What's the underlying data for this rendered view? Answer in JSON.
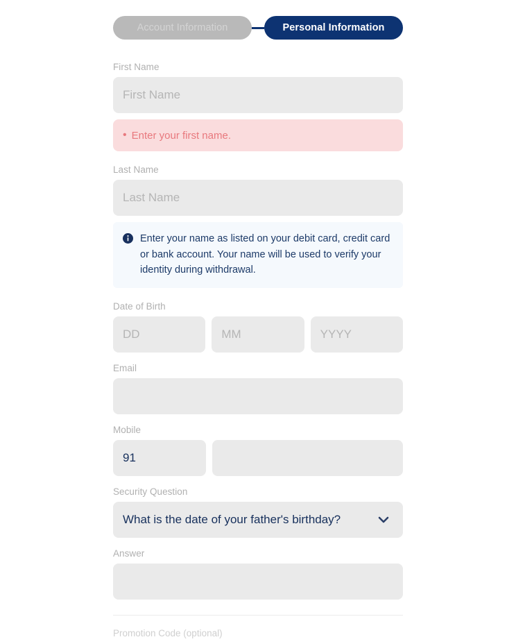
{
  "stepper": {
    "steps": [
      {
        "label": "Account Information",
        "state": "done"
      },
      {
        "label": "Personal Information",
        "state": "active"
      }
    ],
    "active_color": "#0d3372",
    "done_color": "#b9b9b9"
  },
  "form": {
    "first_name": {
      "label": "First Name",
      "placeholder": "First Name",
      "value": "",
      "error": "Enter your first name.",
      "error_bullet": "•",
      "error_bg": "#fadcdd",
      "error_color": "#e8787d"
    },
    "last_name": {
      "label": "Last Name",
      "placeholder": "Last Name",
      "value": "",
      "info": "Enter your name as listed on your debit card, credit card or bank account. Your name will be used to verify your identity during withdrawal.",
      "info_bg": "#f5f9fd",
      "info_color": "#1c3a68"
    },
    "date_of_birth": {
      "label": "Date of Birth",
      "day": {
        "placeholder": "DD",
        "value": ""
      },
      "month": {
        "placeholder": "MM",
        "value": ""
      },
      "year": {
        "placeholder": "YYYY",
        "value": ""
      }
    },
    "email": {
      "label": "Email",
      "placeholder": "",
      "value": ""
    },
    "mobile": {
      "label": "Mobile",
      "country_code": "91",
      "number_placeholder": "",
      "number_value": ""
    },
    "security_question": {
      "label": "Security Question",
      "selected": "What is the date of your father's birthday?"
    },
    "answer": {
      "label": "Answer",
      "placeholder": "",
      "value": ""
    },
    "promotion_code": {
      "label": "Promotion Code (optional)"
    }
  }
}
